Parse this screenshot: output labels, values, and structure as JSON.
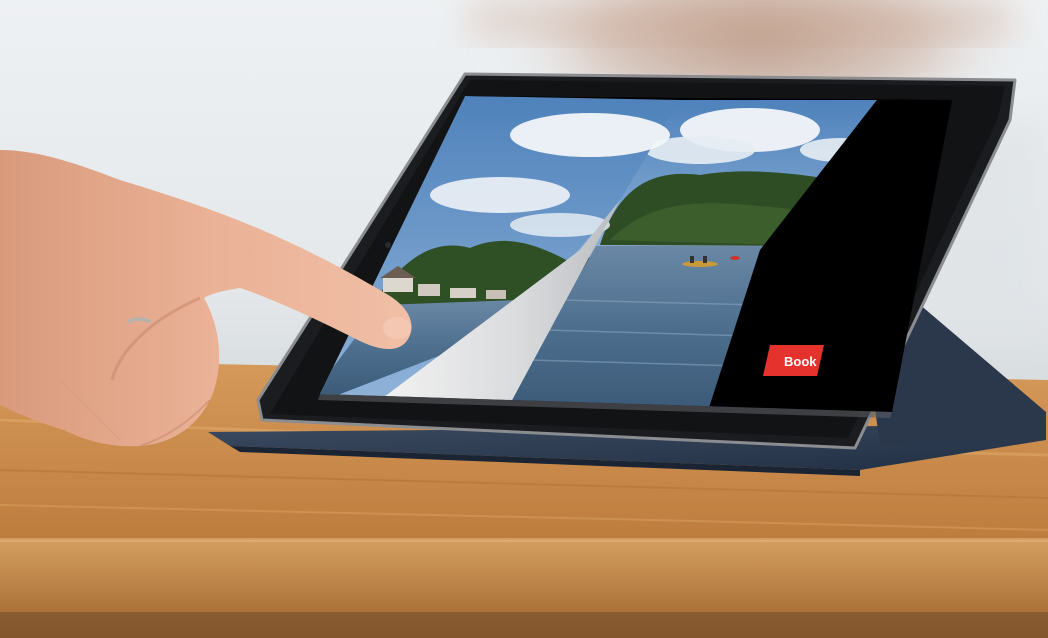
{
  "photo": {
    "subject": "hand-tapping-tablet-on-desk",
    "tablet_screen": {
      "content": "page-curl-lake-photo",
      "cta_button": {
        "label": "Book",
        "color": "#e5322d"
      }
    }
  },
  "colors": {
    "background": "#e9edf0",
    "desk": "#c98a4b",
    "tablet_frame": "#1b1c1f",
    "case": "#2d3a4e",
    "sky": "#5f8fc2",
    "water": "#4d6e8d",
    "trees": "#2e4d24",
    "skin": "#e9ad8f"
  }
}
